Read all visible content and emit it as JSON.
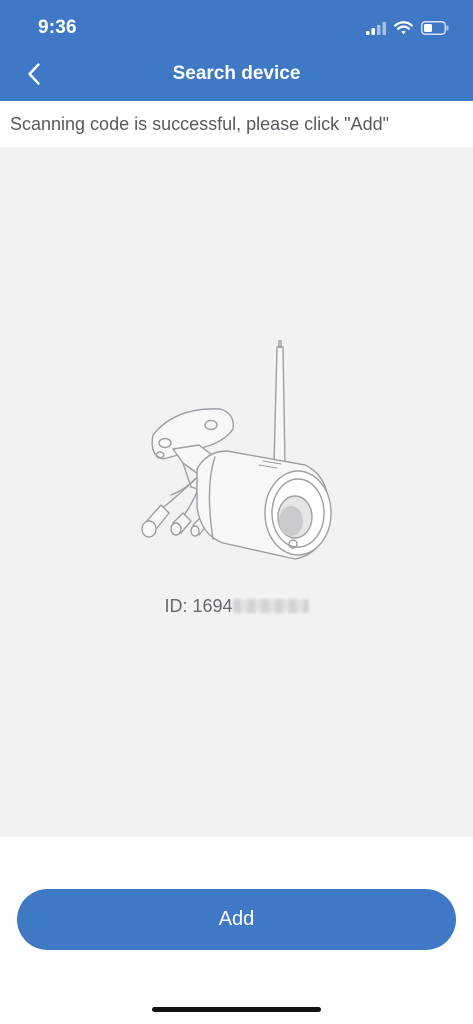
{
  "status_bar": {
    "time": "9:36",
    "icons": [
      "cellular-signal-icon",
      "wifi-icon",
      "battery-icon"
    ]
  },
  "nav": {
    "back_icon": "chevron-left-icon",
    "title": "Search device"
  },
  "message": {
    "text": "Scanning code is successful, please click \"Add\""
  },
  "device": {
    "illustration": "camera-icon",
    "id_prefix": "ID: 1694"
  },
  "actions": {
    "add_label": "Add"
  },
  "colors": {
    "primary": "#3f79c6",
    "device_area_bg": "#f2f2f4",
    "message_text": "#555a60"
  }
}
